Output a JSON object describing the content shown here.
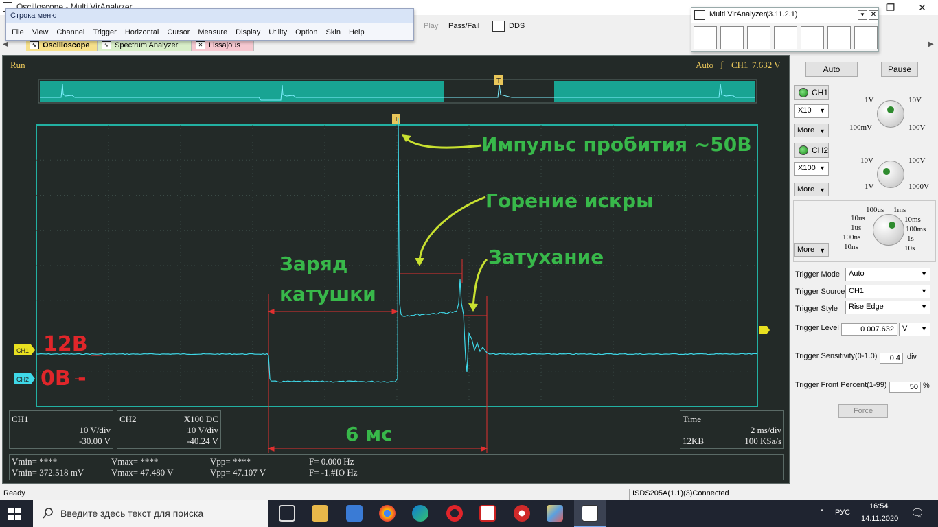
{
  "window": {
    "title": "Oscilloscope - Multi VirAnalyzer",
    "min": "—",
    "max": "❐",
    "close": "✕"
  },
  "menu": {
    "header": "Строка меню",
    "items": [
      "File",
      "View",
      "Channel",
      "Trigger",
      "Horizontal",
      "Cursor",
      "Measure",
      "Display",
      "Utility",
      "Option",
      "Skin",
      "Help"
    ]
  },
  "toolbar": {
    "play": "Play",
    "passfail": "Pass/Fail",
    "dds": "DDS"
  },
  "tabs": [
    "Oscilloscope",
    "Spectrum Analyzer",
    "Lissajous"
  ],
  "scope": {
    "run": "Run",
    "trigger_info": "Auto",
    "trigger_ch": "CH1",
    "trigger_value": "7.632 V",
    "trigger_marker": "T",
    "ch1_tag": "CH1",
    "ch2_tag": "CH2",
    "ch1_box": {
      "name": "CH1",
      "vdiv": "10 V/div",
      "offset": "-30.00 V"
    },
    "ch2_box": {
      "name": "CH2",
      "probe": "X100  DC",
      "vdiv": "10 V/div",
      "offset": "-40.24 V"
    },
    "time_box": {
      "name": "Time",
      "tdiv": "2 ms/div",
      "mem": "12KB",
      "rate": "100 KSa/s"
    },
    "meas": {
      "row1": {
        "vmin": "Vmin= ****",
        "vmax": "Vmax= ****",
        "vpp": "Vpp= ****",
        "f": "F= 0.000 Hz"
      },
      "row2": {
        "vmin": "Vmin= 372.518 mV",
        "vmax": "Vmax= 47.480 V",
        "vpp": "Vpp= 47.107 V",
        "f": "F= -1.#IO Hz"
      }
    }
  },
  "annotations": {
    "breakdown": "Импульс пробития ~50В",
    "spark": "Горение искры",
    "decay": "Затухание",
    "charge1": "Заряд",
    "charge2": "катушки",
    "duration": "6 мс",
    "v12": "12В",
    "v0": "0В -"
  },
  "panel": {
    "auto": "Auto",
    "pause": "Pause",
    "ch1": "CH1",
    "ch2": "CH2",
    "ch1_probe": "X10",
    "ch2_probe": "X100",
    "more": "More",
    "ch1_knob": {
      "tl": "1V",
      "tr": "10V",
      "bl": "100mV",
      "br": "100V"
    },
    "ch2_knob": {
      "tl": "10V",
      "tr": "100V",
      "bl": "1V",
      "br": "1000V"
    },
    "time_knob": {
      "a": "100us",
      "b": "1ms",
      "c": "10us",
      "d": "10ms",
      "e": "1us",
      "f": "100ms",
      "g": "100ns",
      "h": "1s",
      "i": "10ns",
      "j": "10s"
    },
    "trigger_mode_label": "Trigger Mode",
    "trigger_mode": "Auto",
    "trigger_source_label": "Trigger Source",
    "trigger_source": "CH1",
    "trigger_style_label": "Trigger Style",
    "trigger_style": "Rise Edge",
    "trigger_level_label": "Trigger Level",
    "trigger_level": "0 007.632",
    "trigger_level_unit": "V",
    "sens_label": "Trigger Sensitivity(0-1.0)",
    "sens": "0.4",
    "sens_unit": "div",
    "front_label": "Trigger Front Percent(1-99)",
    "front": "50",
    "front_unit": "%",
    "force": "Force"
  },
  "mva": {
    "title": "Multi VirAnalyzer(3.11.2.1)"
  },
  "status": {
    "left": "Ready",
    "right": "ISDS205A(1.1)(3)Connected"
  },
  "taskbar": {
    "search_placeholder": "Введите здесь текст для поиска",
    "lang": "РУС",
    "time": "16:54",
    "date": "14.11.2020"
  },
  "colors": {
    "trace": "#3fd8e8",
    "grid": "#233230",
    "annotation_green": "#38b84a",
    "annotation_red": "#e0262a",
    "marker_line": "#e03030",
    "arrow": "#c8e030"
  }
}
